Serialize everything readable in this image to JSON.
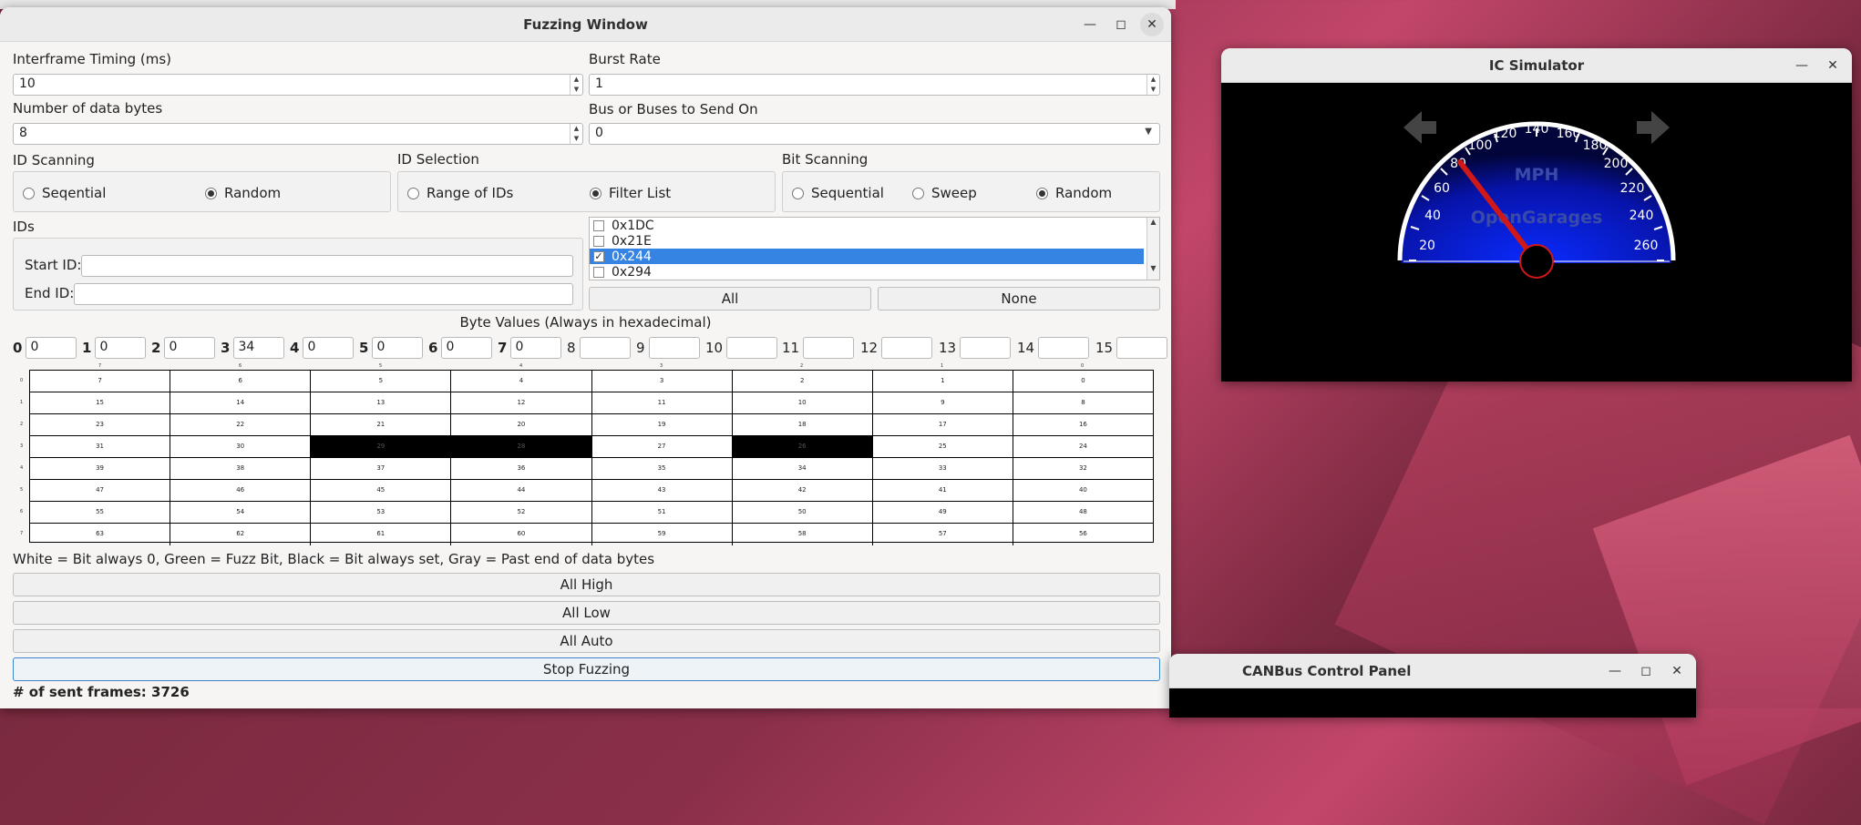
{
  "fuzz": {
    "title": "Fuzzing Window",
    "interframe_label": "Interframe Timing (ms)",
    "interframe_value": "10",
    "burst_label": "Burst Rate",
    "burst_value": "1",
    "ndb_label": "Number of data bytes",
    "ndb_value": "8",
    "bus_label": "Bus or Buses to Send On",
    "bus_value": "0",
    "idscan_label": "ID Scanning",
    "idscan_opt1": "Seqential",
    "idscan_opt2": "Random",
    "idsel_label": "ID Selection",
    "idsel_opt1": "Range of IDs",
    "idsel_opt2": "Filter List",
    "bitscan_label": "Bit Scanning",
    "bitscan_opt1": "Sequential",
    "bitscan_opt2": "Sweep",
    "bitscan_opt3": "Random",
    "ids_label": "IDs",
    "start_label": "Start ID:",
    "end_label": "End ID:",
    "list": [
      "0x1DC",
      "0x21E",
      "0x244",
      "0x294"
    ],
    "all_btn": "All",
    "none_btn": "None",
    "byte_values_label": "Byte Values (Always in hexadecimal)",
    "byte_idx": [
      "0",
      "1",
      "2",
      "3",
      "4",
      "5",
      "6",
      "7",
      "8",
      "9",
      "10",
      "11",
      "12",
      "13",
      "14",
      "15"
    ],
    "byte_vals": [
      "0",
      "0",
      "0",
      "34",
      "0",
      "0",
      "0",
      "0",
      "",
      "",
      "",
      "",
      "",
      "",
      "",
      ""
    ],
    "legend": "White = Bit always 0, Green = Fuzz Bit, Black = Bit always set, Gray = Past end of data bytes",
    "all_high": "All High",
    "all_low": "All Low",
    "all_auto": "All Auto",
    "stop": "Stop Fuzzing",
    "sent_frames": "# of sent frames: 3726",
    "grid": [
      [
        "7",
        "6",
        "5",
        "4",
        "3",
        "2",
        "1",
        "0"
      ],
      [
        "15",
        "14",
        "13",
        "12",
        "11",
        "10",
        "9",
        "8"
      ],
      [
        "23",
        "22",
        "21",
        "20",
        "19",
        "18",
        "17",
        "16"
      ],
      [
        "31",
        "30",
        "29",
        "28",
        "27",
        "26",
        "25",
        "24"
      ],
      [
        "39",
        "38",
        "37",
        "36",
        "35",
        "34",
        "33",
        "32"
      ],
      [
        "47",
        "46",
        "45",
        "44",
        "43",
        "42",
        "41",
        "40"
      ],
      [
        "55",
        "54",
        "53",
        "52",
        "51",
        "50",
        "49",
        "48"
      ],
      [
        "63",
        "62",
        "61",
        "60",
        "59",
        "58",
        "57",
        "56"
      ]
    ],
    "row_idx": [
      "0",
      "1",
      "2",
      "3",
      "4",
      "5",
      "6",
      "7"
    ],
    "col_idx": [
      "7",
      "6",
      "5",
      "4",
      "3",
      "2",
      "1",
      "0"
    ]
  },
  "ic": {
    "title": "IC Simulator",
    "unit": "MPH",
    "brand": "OpenGarages",
    "ticks": [
      "20",
      "40",
      "60",
      "80",
      "100",
      "120",
      "140",
      "160",
      "180",
      "200",
      "220",
      "240",
      "260"
    ]
  },
  "canbus": {
    "title": "CANBus Control Panel"
  }
}
